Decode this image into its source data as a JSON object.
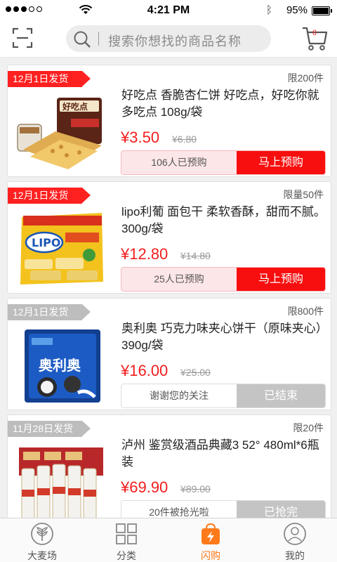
{
  "status_bar": {
    "time": "4:21 PM",
    "battery": "95%",
    "signal_dots": 5,
    "signal_filled": 3
  },
  "search": {
    "placeholder": "搜索你想找的商品名称"
  },
  "cart": {
    "badge": "0"
  },
  "colors": {
    "accent": "#f70e0e",
    "tab_active": "#ff7a1a",
    "ribbon_ended": "#bdbdbd"
  },
  "products": [
    {
      "ship_date": "12月1日发货",
      "limit": "限200件",
      "title": "好吃点  香脆杏仁饼  好吃点，好吃你就多吃点  108g/袋",
      "price": "¥3.50",
      "old_price": "¥6.80",
      "count_text": "106人已预购",
      "action_label": "马上预购",
      "status": "active"
    },
    {
      "ship_date": "12月1日发货",
      "limit": "限量50件",
      "title": "lipo利葡    面包干    柔软香酥，甜而不腻。300g/袋",
      "price": "¥12.80",
      "old_price": "¥14.80",
      "count_text": "25人已预购",
      "action_label": "马上预购",
      "status": "active"
    },
    {
      "ship_date": "12月1日发货",
      "limit": "限800件",
      "title": "奥利奥    巧克力味夹心饼干（原味夹心）390g/袋",
      "price": "¥16.00",
      "old_price": "¥25.00",
      "count_text": "谢谢您的关注",
      "action_label": "已结束",
      "status": "ended"
    },
    {
      "ship_date": "11月28日发货",
      "limit": "限20件",
      "title": "泸州  鉴赏级酒品典藏3  52°  480ml*6瓶装",
      "price": "¥69.90",
      "old_price": "¥89.00",
      "count_text": "20件被抢光啦",
      "action_label": "已抢完",
      "status": "ended"
    }
  ],
  "tabs": [
    {
      "label": "大麦场",
      "icon": "wheat-icon"
    },
    {
      "label": "分类",
      "icon": "grid-icon"
    },
    {
      "label": "闪购",
      "icon": "flash-bag-icon",
      "active": true
    },
    {
      "label": "我的",
      "icon": "profile-icon"
    }
  ]
}
